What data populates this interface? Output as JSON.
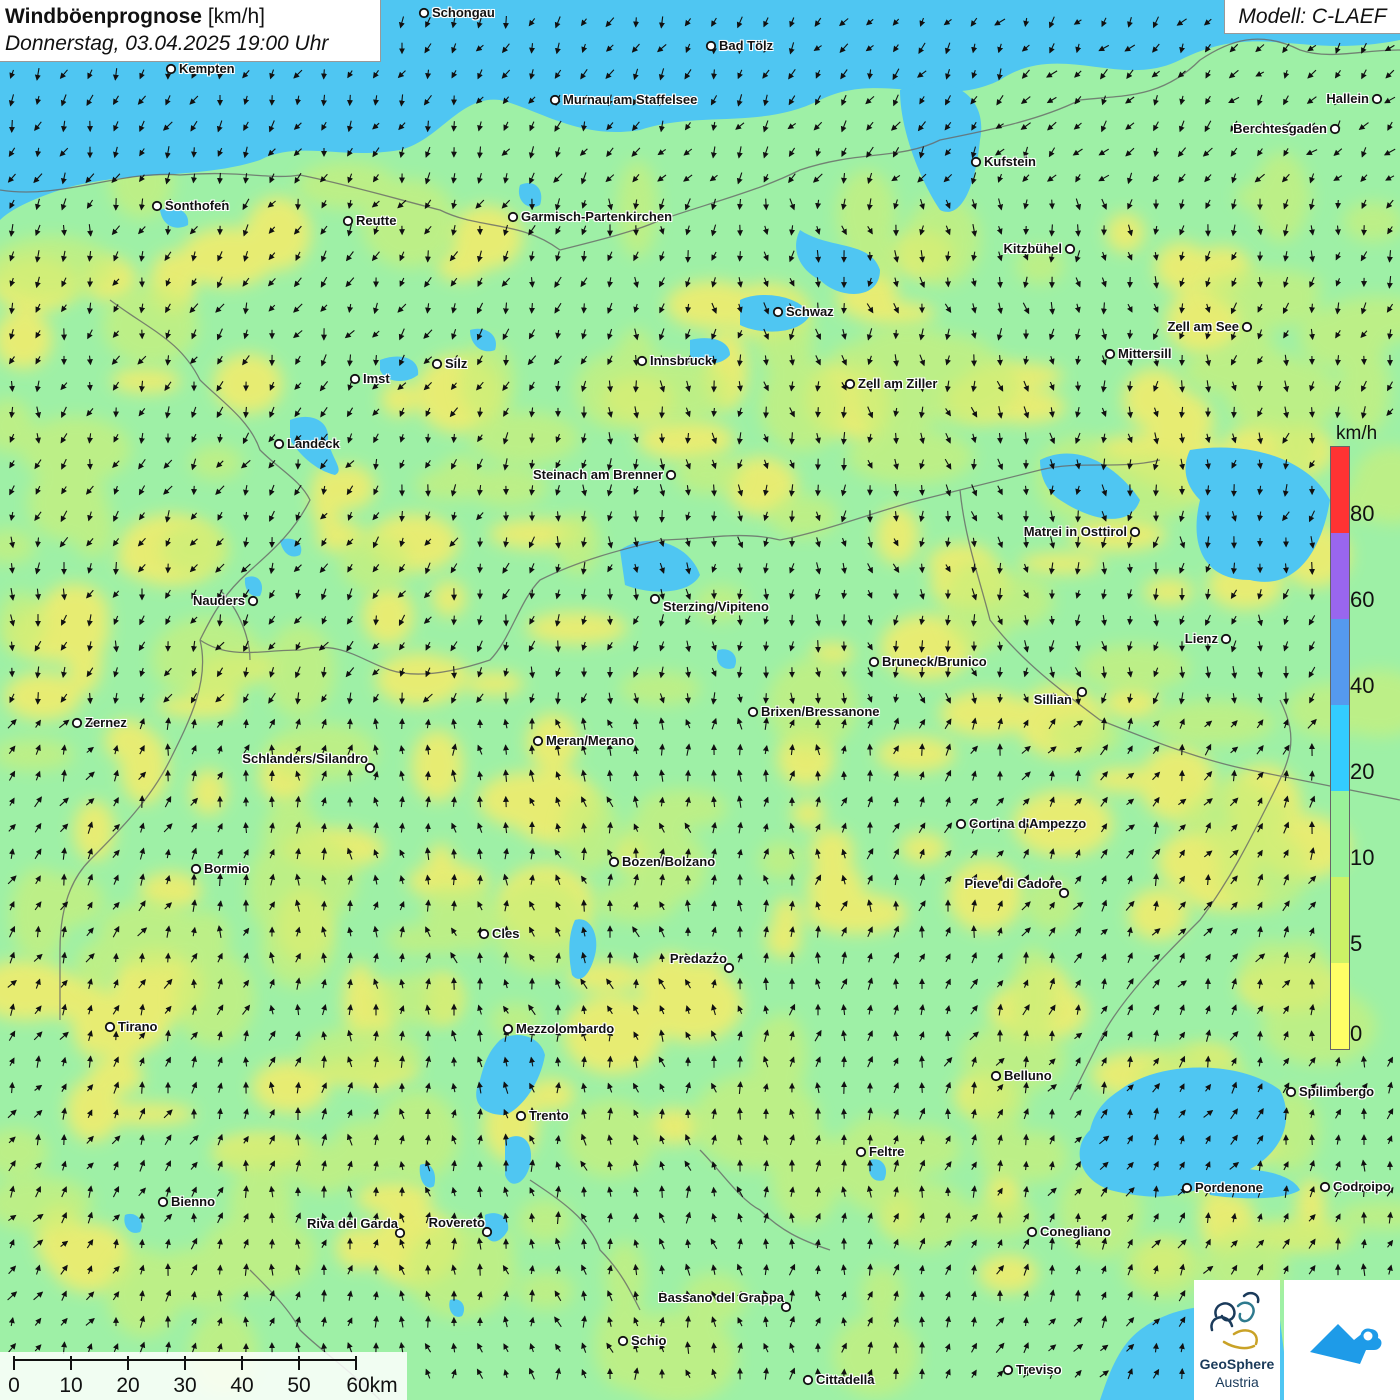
{
  "header": {
    "title_bold": "Windböenprognose",
    "title_unit": "[km/h]",
    "subtitle": "Donnerstag, 03.04.2025 19:00 Uhr",
    "model": "Modell: C-LAEF"
  },
  "cities": [
    {
      "name": "Schongau"
    },
    {
      "name": "Bad Tölz"
    },
    {
      "name": "Kempten"
    },
    {
      "name": "Murnau am Staffelsee"
    },
    {
      "name": "Hallein"
    },
    {
      "name": "Berchtesgaden"
    },
    {
      "name": "Kufstein"
    },
    {
      "name": "Sonthofen"
    },
    {
      "name": "Reutte"
    },
    {
      "name": "Garmisch-Partenkirchen"
    },
    {
      "name": "Kitzbühel"
    },
    {
      "name": "Schwaz"
    },
    {
      "name": "Zell am See"
    },
    {
      "name": "Mittersill"
    },
    {
      "name": "Innsbruck"
    },
    {
      "name": "Silz"
    },
    {
      "name": "Imst"
    },
    {
      "name": "Zell am Ziller"
    },
    {
      "name": "Landeck"
    },
    {
      "name": "Steinach am Brenner"
    },
    {
      "name": "Matrei in Osttirol"
    },
    {
      "name": "Nauders"
    },
    {
      "name": "Sterzing/Vipiteno"
    },
    {
      "name": "Lienz"
    },
    {
      "name": "Bruneck/Brunico"
    },
    {
      "name": "Sillian"
    },
    {
      "name": "Brixen/Bressanone"
    },
    {
      "name": "Zernez"
    },
    {
      "name": "Meran/Merano"
    },
    {
      "name": "Schlanders/Silandro"
    },
    {
      "name": "Cortina d'Ampezzo"
    },
    {
      "name": "Bozen/Bolzano"
    },
    {
      "name": "Bormio"
    },
    {
      "name": "Pieve di Cadore"
    },
    {
      "name": "Cles"
    },
    {
      "name": "Predazzo"
    },
    {
      "name": "Tirano"
    },
    {
      "name": "Mezzolombardo"
    },
    {
      "name": "Belluno"
    },
    {
      "name": "Spilimbergo"
    },
    {
      "name": "Trento"
    },
    {
      "name": "Feltre"
    },
    {
      "name": "Pordenone"
    },
    {
      "name": "Codroipo"
    },
    {
      "name": "Bienno"
    },
    {
      "name": "Riva del Garda"
    },
    {
      "name": "Rovereto"
    },
    {
      "name": "Conegliano"
    },
    {
      "name": "Bassano del Grappa"
    },
    {
      "name": "Schio"
    },
    {
      "name": "Treviso"
    },
    {
      "name": "Cittadella"
    }
  ],
  "legend": {
    "unit": "km/h",
    "classes": [
      {
        "from": 0,
        "to": 5,
        "color": "#ffff66"
      },
      {
        "from": 5,
        "to": 10,
        "color": "#ccf266"
      },
      {
        "from": 10,
        "to": 20,
        "color": "#99f299"
      },
      {
        "from": 20,
        "to": 40,
        "color": "#33ccff"
      },
      {
        "from": 40,
        "to": 60,
        "color": "#5599ee"
      },
      {
        "from": 60,
        "to": 80,
        "color": "#9966ee"
      },
      {
        "from": 80,
        "to": null,
        "color": "#ff3333"
      }
    ],
    "labels": [
      "0",
      "5",
      "10",
      "20",
      "40",
      "60",
      "80"
    ]
  },
  "scalebar": {
    "labels": [
      "0",
      "10",
      "20",
      "30",
      "40",
      "50",
      "60km"
    ]
  },
  "logos": {
    "geosphere_line1": "GeoSphere",
    "geosphere_line2": "Austria",
    "geosphere_icon": "geosphere-logo-icon",
    "second_icon": "mountain-cloud-logo-icon"
  },
  "colors": {
    "calm_yellow": "#f4ec6a",
    "light_green": "#c9ef7a",
    "green": "#9ef0a6",
    "blue": "#4fc6f2",
    "border": "#666666",
    "accent_blue": "#1e9be8"
  }
}
